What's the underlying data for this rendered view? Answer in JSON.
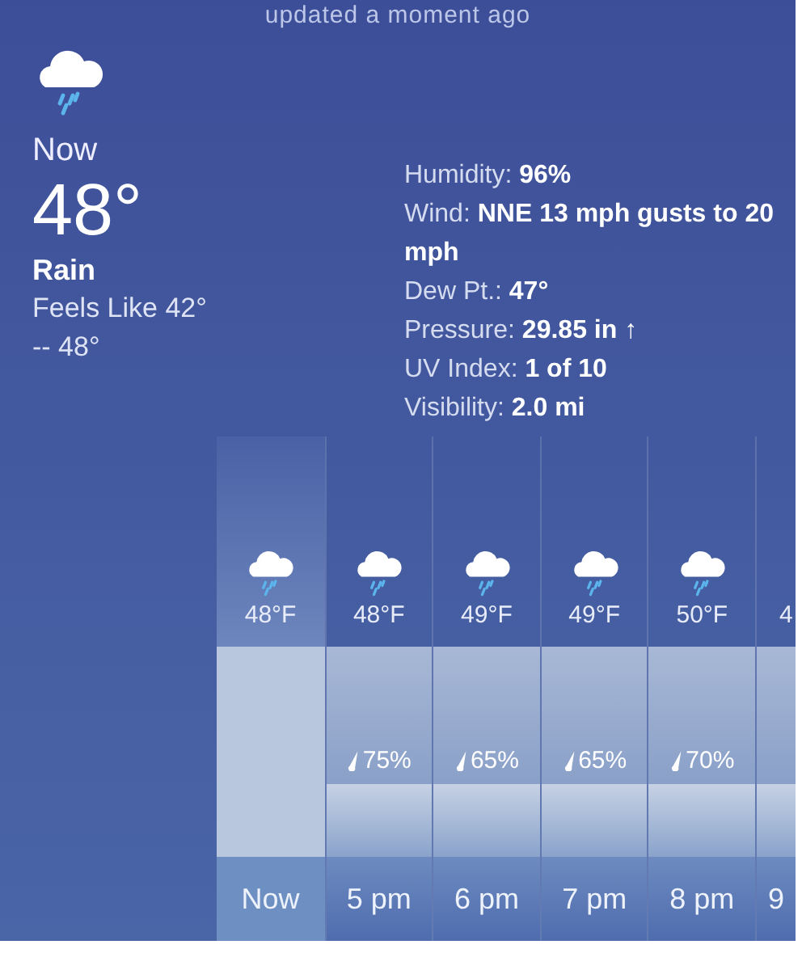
{
  "status": "updated a moment ago",
  "current": {
    "label": "Now",
    "temperature": "48°",
    "condition": "Rain",
    "feels_like": "Feels Like 42°",
    "high_low": "-- 48°"
  },
  "details": [
    {
      "text": "Humidity: **96%**"
    },
    {
      "text": "Wind: **NNE 13 mph gusts to 20 mph**"
    },
    {
      "text": "Dew Pt.: **47°**"
    },
    {
      "text": "Pressure: **29.85 in ↑**"
    },
    {
      "text": "UV Index: **1 of 10**"
    },
    {
      "text": "Visibility: **2.0 mi**"
    }
  ],
  "hourly": [
    {
      "time": "Now",
      "temp": "48°F",
      "selected": true
    },
    {
      "time": "5 pm",
      "temp": "48°F",
      "precip": "75%",
      "selected": false
    },
    {
      "time": "6 pm",
      "temp": "49°F",
      "precip": "65%",
      "selected": false
    },
    {
      "time": "7 pm",
      "temp": "49°F",
      "precip": "65%",
      "selected": false
    },
    {
      "time": "8 pm",
      "temp": "50°F",
      "precip": "70%",
      "selected": false
    },
    {
      "time": "9",
      "temp": "4",
      "selected": false
    }
  ]
}
